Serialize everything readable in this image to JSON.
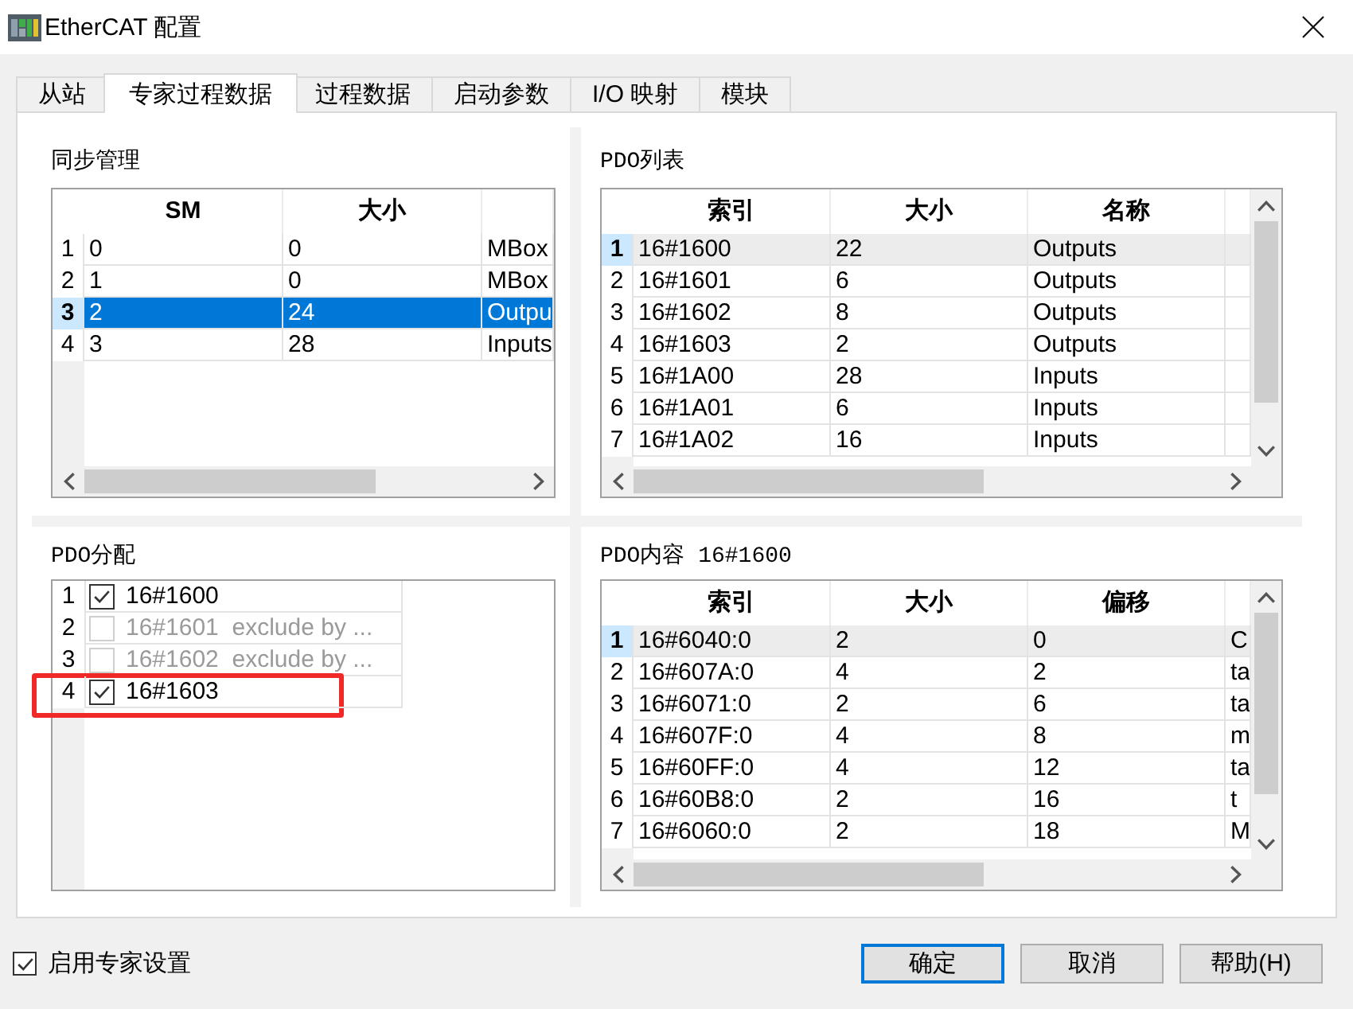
{
  "window": {
    "title": "EtherCAT 配置"
  },
  "tabs": [
    {
      "label": "从站",
      "selected": false
    },
    {
      "label": "专家过程数据",
      "selected": true
    },
    {
      "label": "过程数据",
      "selected": false
    },
    {
      "label": "启动参数",
      "selected": false
    },
    {
      "label": "I/O 映射",
      "selected": false
    },
    {
      "label": "模块",
      "selected": false
    }
  ],
  "sync_manager": {
    "title": "同步管理",
    "focused": true,
    "columns": [
      "SM",
      "大小"
    ],
    "rows": [
      {
        "number": "1",
        "cells": [
          "0",
          "0",
          "MBox"
        ],
        "selected": false
      },
      {
        "number": "2",
        "cells": [
          "1",
          "0",
          "MBox"
        ],
        "selected": false
      },
      {
        "number": "3",
        "cells": [
          "2",
          "24",
          "Outpu"
        ],
        "selected": true
      },
      {
        "number": "4",
        "cells": [
          "3",
          "28",
          "Inputs"
        ],
        "selected": false
      }
    ]
  },
  "pdo_list": {
    "title": "PDO列表",
    "focused": false,
    "columns": [
      "索引",
      "大小",
      "名称"
    ],
    "rows": [
      {
        "number": "1",
        "cells": [
          "16#1600",
          "22",
          "Outputs"
        ],
        "selected": true
      },
      {
        "number": "2",
        "cells": [
          "16#1601",
          "6",
          "Outputs"
        ],
        "selected": false
      },
      {
        "number": "3",
        "cells": [
          "16#1602",
          "8",
          "Outputs"
        ],
        "selected": false
      },
      {
        "number": "4",
        "cells": [
          "16#1603",
          "2",
          "Outputs"
        ],
        "selected": false
      },
      {
        "number": "5",
        "cells": [
          "16#1A00",
          "28",
          "Inputs"
        ],
        "selected": false
      },
      {
        "number": "6",
        "cells": [
          "16#1A01",
          "6",
          "Inputs"
        ],
        "selected": false
      },
      {
        "number": "7",
        "cells": [
          "16#1A02",
          "16",
          "Inputs"
        ],
        "selected": false
      }
    ]
  },
  "pdo_assignment": {
    "title": "PDO分配",
    "items": [
      {
        "number": "1",
        "label": "16#1600",
        "checked": true,
        "disabled": false,
        "highlighted": false
      },
      {
        "number": "2",
        "label": "16#1601  exclude by ...",
        "checked": false,
        "disabled": true,
        "highlighted": false
      },
      {
        "number": "3",
        "label": "16#1602  exclude by ...",
        "checked": false,
        "disabled": true,
        "highlighted": false
      },
      {
        "number": "4",
        "label": "16#1603",
        "checked": true,
        "disabled": false,
        "highlighted": true
      }
    ]
  },
  "pdo_content": {
    "title": "PDO内容 16#1600",
    "focused": false,
    "columns": [
      "索引",
      "大小",
      "偏移"
    ],
    "rows": [
      {
        "number": "1",
        "cells": [
          "16#6040:0",
          "2",
          "0",
          "C"
        ],
        "selected": true
      },
      {
        "number": "2",
        "cells": [
          "16#607A:0",
          "4",
          "2",
          "ta"
        ],
        "selected": false
      },
      {
        "number": "3",
        "cells": [
          "16#6071:0",
          "2",
          "6",
          "ta"
        ],
        "selected": false
      },
      {
        "number": "4",
        "cells": [
          "16#607F:0",
          "4",
          "8",
          "m"
        ],
        "selected": false
      },
      {
        "number": "5",
        "cells": [
          "16#60FF:0",
          "4",
          "12",
          "ta"
        ],
        "selected": false
      },
      {
        "number": "6",
        "cells": [
          "16#60B8:0",
          "2",
          "16",
          "t"
        ],
        "selected": false
      },
      {
        "number": "7",
        "cells": [
          "16#6060:0",
          "2",
          "18",
          "M"
        ],
        "selected": false
      }
    ]
  },
  "expert_settings": {
    "label": "启用专家设置",
    "checked": true
  },
  "buttons": [
    {
      "label": "确定",
      "default": true
    },
    {
      "label": "取消",
      "default": false
    },
    {
      "label": "帮助(H)",
      "default": false
    }
  ]
}
